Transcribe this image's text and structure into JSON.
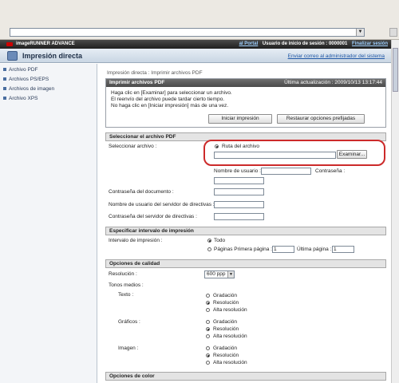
{
  "topbar": {
    "brand": "imageRUNNER ADVANCE",
    "portal_link": "al Portal",
    "login_user_label": "Usuario de inicio de sesión : 0000001",
    "logout_link": "Finalizar sesión"
  },
  "header": {
    "title": "Impresión directa",
    "mail_link": "Enviar correo al administrador del sistema"
  },
  "sidebar": {
    "items": [
      {
        "label": "Archivo PDF"
      },
      {
        "label": "Archivos PS/EPS"
      },
      {
        "label": "Archivos de imagen"
      },
      {
        "label": "Archivo XPS"
      }
    ]
  },
  "main": {
    "breadcrumb": "Impresión directa : Imprimir archivos PDF",
    "panel_title": "Imprimir archivos PDF",
    "last_update": "Última actualización : 2009/10/13 13:17:44",
    "instructions": [
      "Haga clic en [Examinar] para seleccionar un archivo.",
      "El reenvío del archivo puede tardar cierto tiempo.",
      "No haga clic en [Iniciar impresión] más de una vez."
    ],
    "start_print_button": "Iniciar impresión",
    "restore_button": "Restaurar opciones prefijadas",
    "select_section": {
      "title": "Seleccionar el archivo PDF",
      "select_file_label": "Seleccionar archivo :",
      "file_path_radio": "Ruta del archivo",
      "browse_button": "Examinar...",
      "username_label": "Nombre de usuario :",
      "password_label": "Contraseña :",
      "doc_password_label": "Contraseña del documento :",
      "policy_user_label": "Nombre de usuario del servidor de directivas :",
      "policy_password_label": "Contraseña del servidor de directivas :"
    },
    "range_section": {
      "title": "Especificar intervalo de impresión",
      "interval_label": "Intervalo de impresión :",
      "all_option": "Todo",
      "pages_option": "Páginas Primera página :",
      "first_page_value": "1",
      "last_page_label": "Última página :",
      "last_page_value": "1"
    },
    "quality_section": {
      "title": "Opciones de calidad",
      "resolution_label": "Resolución :",
      "resolution_value": "600 ppp",
      "halftones_label": "Tonos medios :",
      "text_label": "Texto :",
      "graphics_label": "Gráficos :",
      "image_label": "Imagen :",
      "options": [
        "Gradación",
        "Resolución",
        "Alta resolución"
      ]
    },
    "color_section": {
      "title": "Opciones de color"
    }
  }
}
